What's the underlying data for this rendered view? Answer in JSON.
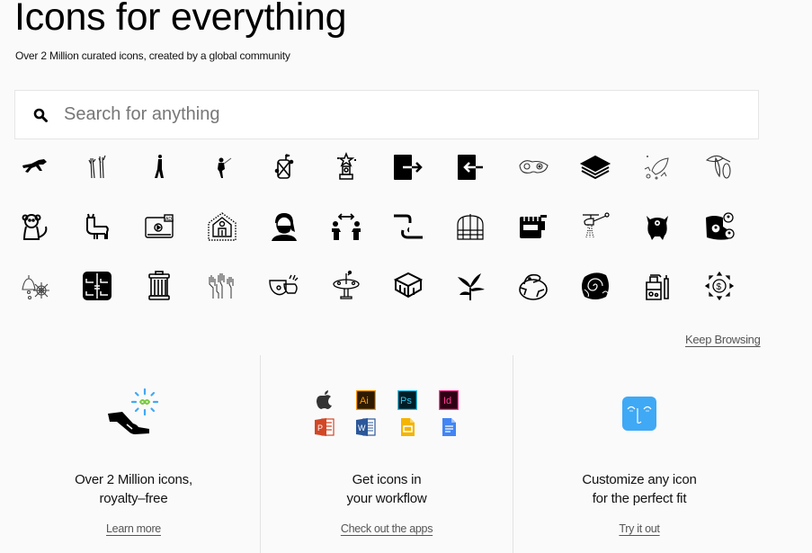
{
  "header": {
    "title": "Icons for everything",
    "subtitle": "Over 2 Million curated icons, created by a global community"
  },
  "search": {
    "placeholder": "Search for anything",
    "value": "",
    "icon": "search-icon"
  },
  "icon_grid": {
    "rows": [
      [
        "grasshopper-icon",
        "dancers-icon",
        "woman-standing-icon",
        "dancer-icon",
        "drum-icon",
        "trophy-star-icon",
        "exit-door-icon",
        "enter-door-icon",
        "eye-mask-icon",
        "sandwich-icon",
        "rocket-sketch-icon",
        "cacao-plant-icon"
      ],
      [
        "monkey-icon",
        "llama-icon",
        "video-ad-icon",
        "stay-home-icon",
        "woman-mask-icon",
        "social-distance-icon",
        "wash-hands-icon",
        "greenhouse-icon",
        "stove-icon",
        "helicopter-water-icon",
        "monster-icon",
        "group-network-icon"
      ],
      [
        "halloween-bell-icon",
        "bunk-beds-icon",
        "trash-can-icon",
        "raised-hands-icon",
        "virus-handshake-icon",
        "fountain-icon",
        "building-icon",
        "bird-of-paradise-icon",
        "dinosaur-egg-icon",
        "galaxy-icon",
        "spray-bottle-icon",
        "dollar-growth-icon"
      ]
    ]
  },
  "keep_browsing": "Keep Browsing",
  "features": [
    {
      "icon": "hand-infinity-icon",
      "title_line1": "Over 2 Million icons,",
      "title_line2": "royalty–free",
      "link": "Learn more"
    },
    {
      "icon": "apps-icon",
      "title_line1": "Get icons in",
      "title_line2": "your workflow",
      "link": "Check out the apps",
      "apps": [
        {
          "name": "apple-icon",
          "label": "",
          "color": "#333333"
        },
        {
          "name": "illustrator-icon",
          "label": "Ai",
          "color": "#ff9a00",
          "bg": "#2e1a00"
        },
        {
          "name": "photoshop-icon",
          "label": "Ps",
          "color": "#31c5f0",
          "bg": "#001d26"
        },
        {
          "name": "indesign-icon",
          "label": "Id",
          "color": "#ff3f94",
          "bg": "#2e0013"
        },
        {
          "name": "powerpoint-icon",
          "label": "P",
          "color": "#d24726"
        },
        {
          "name": "word-icon",
          "label": "W",
          "color": "#2b579a"
        },
        {
          "name": "google-slides-icon",
          "label": "",
          "color": "#f4b400"
        },
        {
          "name": "google-docs-icon",
          "label": "",
          "color": "#4285f4"
        }
      ]
    },
    {
      "icon": "face-customize-icon",
      "title_line1": "Customize any icon",
      "title_line2": "for the perfect fit",
      "link": "Try it out",
      "color": "#3fa9f5"
    }
  ]
}
